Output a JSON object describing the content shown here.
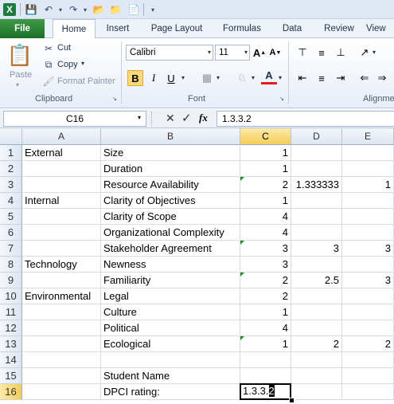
{
  "quick_access": {
    "logo": "X",
    "save_icon": "save-icon",
    "undo_icon": "undo-icon",
    "redo_icon": "redo-icon"
  },
  "ribbon_tabs": [
    "File",
    "Home",
    "Insert",
    "Page Layout",
    "Formulas",
    "Data",
    "Review",
    "View"
  ],
  "ribbon": {
    "clipboard": {
      "paste": "Paste",
      "cut": "Cut",
      "copy": "Copy",
      "format_painter": "Format Painter",
      "label": "Clipboard"
    },
    "font": {
      "family": "Calibri",
      "size": "11",
      "label": "Font",
      "bold": "B",
      "italic": "I",
      "underline": "U",
      "font_color": "A"
    },
    "alignment": {
      "label": "Alignme"
    }
  },
  "formula_bar": {
    "name_box": "C16",
    "fx": "fx",
    "content": "1.3.3.2"
  },
  "columns": [
    "A",
    "B",
    "C",
    "D",
    "E"
  ],
  "selected_column": "C",
  "rows": [
    {
      "n": "1",
      "a": "External",
      "b": "Size",
      "c": "1",
      "d": "",
      "e": ""
    },
    {
      "n": "2",
      "a": "",
      "b": "Duration",
      "c": "1",
      "d": "",
      "e": ""
    },
    {
      "n": "3",
      "a": "",
      "b": "Resource Availability",
      "c": "2",
      "d": "1.333333",
      "e": "1"
    },
    {
      "n": "4",
      "a": "Internal",
      "b": "Clarity of Objectives",
      "c": "1",
      "d": "",
      "e": ""
    },
    {
      "n": "5",
      "a": "",
      "b": "Clarity of Scope",
      "c": "4",
      "d": "",
      "e": ""
    },
    {
      "n": "6",
      "a": "",
      "b": "Organizational Complexity",
      "c": "4",
      "d": "",
      "e": ""
    },
    {
      "n": "7",
      "a": "",
      "b": "Stakeholder Agreement",
      "c": "3",
      "d": "3",
      "e": "3"
    },
    {
      "n": "8",
      "a": "Technology",
      "b": "Newness",
      "c": "3",
      "d": "",
      "e": ""
    },
    {
      "n": "9",
      "a": "",
      "b": "Familiarity",
      "c": "2",
      "d": "2.5",
      "e": "3"
    },
    {
      "n": "10",
      "a": "Environmental",
      "b": "Legal",
      "c": "2",
      "d": "",
      "e": ""
    },
    {
      "n": "11",
      "a": "",
      "b": "Culture",
      "c": "1",
      "d": "",
      "e": ""
    },
    {
      "n": "12",
      "a": "",
      "b": "Political",
      "c": "4",
      "d": "",
      "e": ""
    },
    {
      "n": "13",
      "a": "",
      "b": "Ecological",
      "c": "1",
      "d": "2",
      "e": "2"
    },
    {
      "n": "14",
      "a": "",
      "b": "",
      "c": "",
      "d": "",
      "e": ""
    },
    {
      "n": "15",
      "a": "",
      "b": "Student Name",
      "c": "",
      "d": "",
      "e": ""
    },
    {
      "n": "16",
      "a": "",
      "b": "DPCI rating:",
      "c": "1.3.3.2",
      "d": "",
      "e": ""
    }
  ],
  "active_cell": {
    "ref": "C16",
    "before_cursor": "1.3.3.",
    "cursor_char": "2"
  },
  "colors": {
    "file_tab": "#2e7d32",
    "selected_header": "#f6cd5a",
    "error_flag": "#1a8a2a"
  }
}
